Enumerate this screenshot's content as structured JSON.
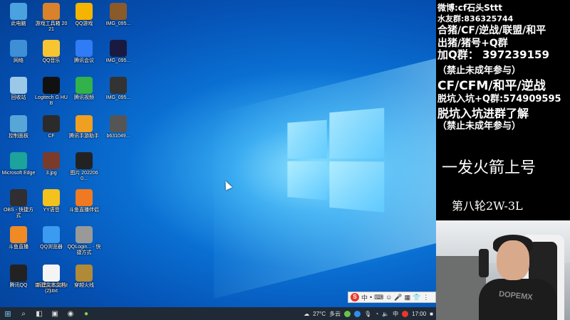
{
  "desktop": {
    "icons": [
      {
        "label": "此电脑",
        "color": "#4aa3df"
      },
      {
        "label": "网络",
        "color": "#3f8fd6"
      },
      {
        "label": "回收站",
        "color": "#9cc8e8"
      },
      {
        "label": "控制面板",
        "color": "#58a6d8"
      },
      {
        "label": "Microsoft Edge",
        "color": "#1ba39c"
      },
      {
        "label": "OBS - 快捷方式",
        "color": "#302e31"
      },
      {
        "label": "斗鱼直播",
        "color": "#f08a24"
      },
      {
        "label": "腾讯QQ",
        "color": "#222222"
      },
      {
        "label": "游戏工具箱 2021",
        "color": "#d9822b"
      },
      {
        "label": "QQ音乐",
        "color": "#f7c531"
      },
      {
        "label": "Logitech G HUB",
        "color": "#111111"
      },
      {
        "label": "CF",
        "color": "#2b2b2b"
      },
      {
        "label": "3.jpg",
        "color": "#7a3b2a"
      },
      {
        "label": "YY语音",
        "color": "#f3c21d"
      },
      {
        "label": "QQ浏览器",
        "color": "#3a9bf0"
      },
      {
        "label": "新建文本文档.txt",
        "color": "#f4f4f4"
      },
      {
        "label": "QQ游戏",
        "color": "#f5b400"
      },
      {
        "label": "腾讯会议",
        "color": "#2f7cf6"
      },
      {
        "label": "腾讯视频",
        "color": "#31b24a"
      },
      {
        "label": "腾讯手游助手",
        "color": "#f0a020"
      },
      {
        "label": "图片 2022060...",
        "color": "#222222"
      },
      {
        "label": "斗鱼直播伴侣",
        "color": "#ef7a22"
      },
      {
        "label": "QQLogin... - 快捷方式",
        "color": "#999999"
      },
      {
        "label": "穿越火线",
        "color": "#b08a36"
      },
      {
        "label": "新建文本文档 (2).txt",
        "color": "#f4f4f4"
      },
      {
        "label": "IMG_095...",
        "color": "#8a5a2a"
      },
      {
        "label": "IMG_095...",
        "color": "#1a1a40"
      },
      {
        "label": "IMG_095...",
        "color": "#333333"
      },
      {
        "label": "b631049...",
        "color": "#555555"
      }
    ]
  },
  "ime": {
    "label": "中",
    "extras": [
      "•",
      "⌨",
      "☺",
      "🎤",
      "▦",
      "👕",
      "⋮"
    ]
  },
  "taskbar": {
    "start_icon": "windows-start-icon",
    "search_icon": "search-icon",
    "apps": [
      "◧",
      "▣",
      "◉",
      "●"
    ],
    "weather": "27°C",
    "weather_desc": "多云",
    "time": "17:00",
    "lang": "中",
    "notif": "■"
  },
  "panel": {
    "line1": "微博:cf石头Sttt",
    "line2": "水友群:836325744",
    "line3": "合猪/CF/逆战/联盟/和平",
    "line4": "出猪/猪号+Q群",
    "line5": "加Q群： 397239159",
    "line6": "（禁止未成年参与）",
    "line7": "CF/CFM/和平/逆战",
    "line8": "脱坑入坑+Q群:574909595",
    "line9": "脱坑入坑进群了解",
    "line10": "（禁止未成年参与）",
    "slogan": "一发火箭上号",
    "round": "第八轮2W-3L"
  },
  "webcam": {
    "shirt_text": "DOPEMX"
  }
}
